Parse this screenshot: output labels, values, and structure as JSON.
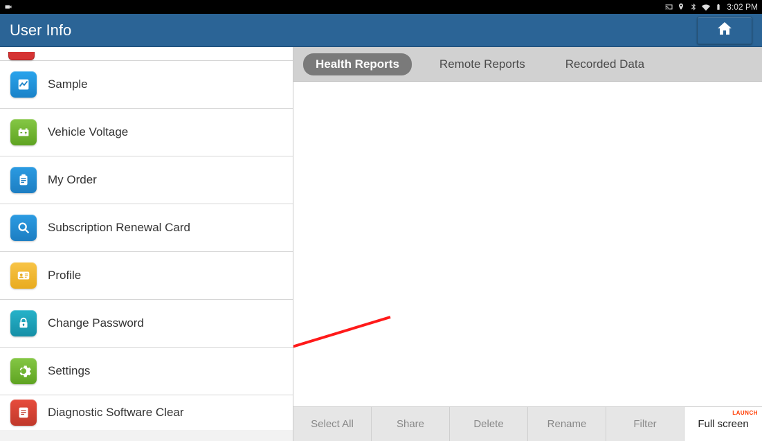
{
  "status": {
    "time": "3:02 PM"
  },
  "header": {
    "title": "User Info"
  },
  "sidebar": {
    "items": [
      {
        "label": "Sample"
      },
      {
        "label": "Vehicle Voltage"
      },
      {
        "label": "My Order"
      },
      {
        "label": "Subscription Renewal Card"
      },
      {
        "label": "Profile"
      },
      {
        "label": "Change Password"
      },
      {
        "label": "Settings"
      },
      {
        "label": "Diagnostic Software Clear"
      }
    ]
  },
  "tabs": {
    "items": [
      {
        "label": "Health Reports"
      },
      {
        "label": "Remote Reports"
      },
      {
        "label": "Recorded Data"
      }
    ]
  },
  "bottom": {
    "items": [
      {
        "label": "Select All"
      },
      {
        "label": "Share"
      },
      {
        "label": "Delete"
      },
      {
        "label": "Rename"
      },
      {
        "label": "Filter"
      },
      {
        "label": "Full screen"
      }
    ],
    "brand": "LAUNCH"
  }
}
